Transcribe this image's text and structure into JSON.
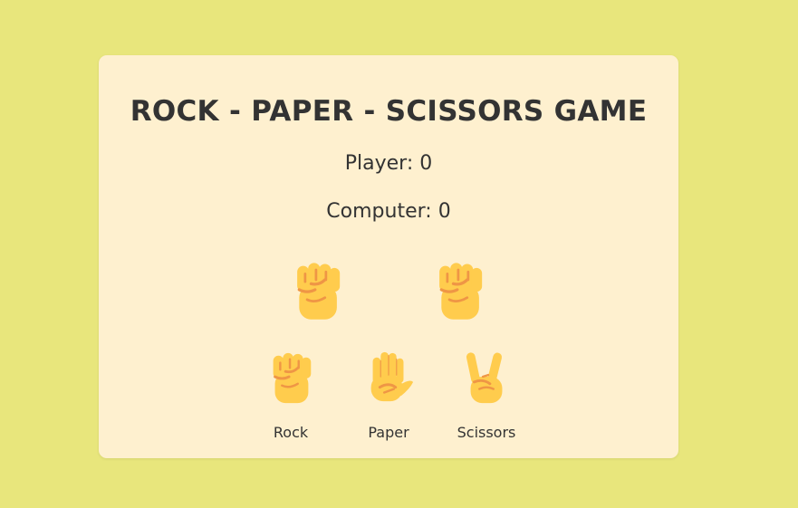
{
  "title": "ROCK - PAPER - SCISSORS GAME",
  "scores": {
    "player": {
      "label": "Player",
      "value": "0"
    },
    "computer": {
      "label": "Computer",
      "value": "0"
    }
  },
  "display": {
    "player_hand": "rock-hand-icon",
    "computer_hand": "rock-hand-icon"
  },
  "choices": [
    {
      "label": "Rock",
      "icon": "rock-hand-icon"
    },
    {
      "label": "Paper",
      "icon": "paper-hand-icon"
    },
    {
      "label": "Scissors",
      "icon": "scissors-hand-icon"
    }
  ],
  "colors": {
    "background": "#e8e67c",
    "card": "#fef0cf",
    "text": "#333333",
    "skin": "#ffcc4d",
    "skin_shade": "#ef9645"
  }
}
